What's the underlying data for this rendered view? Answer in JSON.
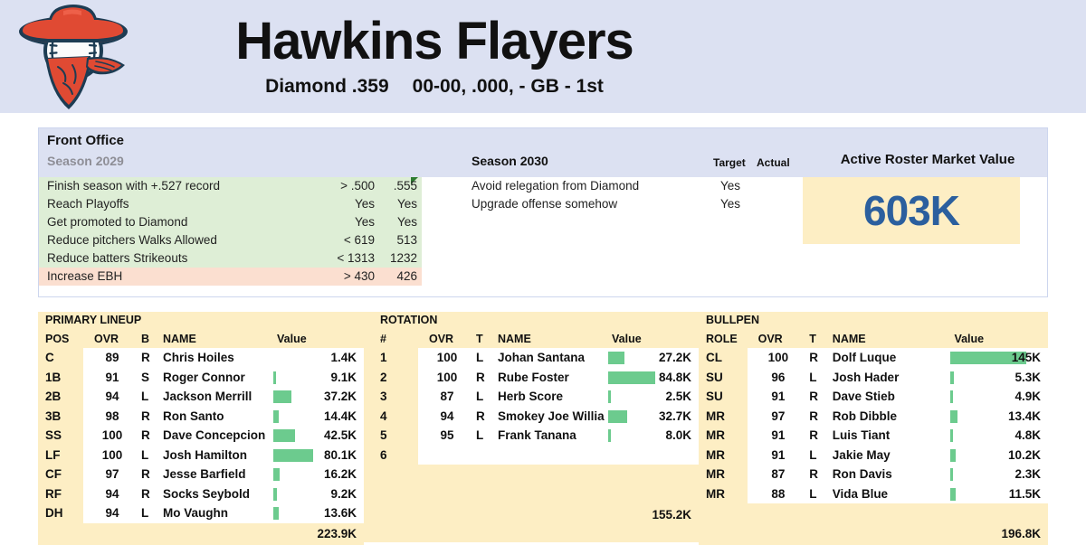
{
  "header": {
    "logo_icon": "outlaw-baseball-logo",
    "team_name": "Hawkins Flayers",
    "league": "Diamond .359",
    "record": "00-00, .000, - GB - 1st"
  },
  "front_office": {
    "panel_title": "Front Office",
    "left_season_label": "Season 2029",
    "right_season_label": "Season 2030",
    "target_header": "Target",
    "actual_header": "Actual",
    "market_value_title": "Active Roster Market Value",
    "market_value": "603K",
    "market_value_color": "#2b5f9e",
    "past_goals": [
      {
        "label": "Finish season with +.527 record",
        "target": "> .500",
        "actual": ".555",
        "status": "met",
        "flag": true
      },
      {
        "label": "Reach Playoffs",
        "target": "Yes",
        "actual": "Yes",
        "status": "met",
        "flag": false
      },
      {
        "label": "Get promoted to Diamond",
        "target": "Yes",
        "actual": "Yes",
        "status": "met",
        "flag": false
      },
      {
        "label": "Reduce pitchers Walks Allowed",
        "target": "< 619",
        "actual": "513",
        "status": "met",
        "flag": false
      },
      {
        "label": "Reduce batters Strikeouts",
        "target": "< 1313",
        "actual": "1232",
        "status": "met",
        "flag": false
      },
      {
        "label": "Increase EBH",
        "target": "> 430",
        "actual": "426",
        "status": "miss",
        "flag": false
      }
    ],
    "current_goals": [
      {
        "label": "Avoid relegation from Diamond",
        "target": "Yes",
        "actual": ""
      },
      {
        "label": "Upgrade offense somehow",
        "target": "Yes",
        "actual": ""
      }
    ]
  },
  "roster": {
    "lineup": {
      "section_title": "PRIMARY LINEUP",
      "headers": {
        "pos": "POS",
        "ovr": "OVR",
        "hand": "B",
        "name": "NAME",
        "value": "Value"
      },
      "rows": [
        {
          "pos": "C",
          "ovr": "89",
          "ovr_style": "ovr-yellow",
          "hand": "R",
          "name": "Chris Hoiles",
          "value": "1.4K",
          "bar_pct": 0
        },
        {
          "pos": "1B",
          "ovr": "91",
          "ovr_style": "ovr-green",
          "hand": "S",
          "name": "Roger Connor",
          "value": "9.1K",
          "bar_pct": 4
        },
        {
          "pos": "2B",
          "ovr": "94",
          "ovr_style": "ovr-green",
          "hand": "L",
          "name": "Jackson Merrill",
          "value": "37.2K",
          "bar_pct": 24
        },
        {
          "pos": "3B",
          "ovr": "98",
          "ovr_style": "ovr-green",
          "hand": "R",
          "name": "Ron Santo",
          "value": "14.4K",
          "bar_pct": 7
        },
        {
          "pos": "SS",
          "ovr": "100",
          "ovr_style": "ovr-black",
          "hand": "R",
          "name": "Dave Concepcion",
          "value": "42.5K",
          "bar_pct": 28
        },
        {
          "pos": "LF",
          "ovr": "100",
          "ovr_style": "ovr-black",
          "hand": "L",
          "name": "Josh Hamilton",
          "value": "80.1K",
          "bar_pct": 52
        },
        {
          "pos": "CF",
          "ovr": "97",
          "ovr_style": "ovr-green",
          "hand": "R",
          "name": "Jesse Barfield",
          "value": "16.2K",
          "bar_pct": 8
        },
        {
          "pos": "RF",
          "ovr": "94",
          "ovr_style": "ovr-green",
          "hand": "R",
          "name": "Socks Seybold",
          "value": "9.2K",
          "bar_pct": 5
        },
        {
          "pos": "DH",
          "ovr": "94",
          "ovr_style": "ovr-green",
          "hand": "L",
          "name": "Mo Vaughn",
          "value": "13.6K",
          "bar_pct": 7
        }
      ],
      "total": "223.9K"
    },
    "rotation": {
      "section_title": "ROTATION",
      "headers": {
        "pos": "#",
        "ovr": "OVR",
        "hand": "T",
        "name": "NAME",
        "value": "Value"
      },
      "rows": [
        {
          "pos": "1",
          "ovr": "100",
          "ovr_style": "ovr-black",
          "hand": "L",
          "name": "Johan Santana",
          "value": "27.2K",
          "bar_pct": 22,
          "small": false
        },
        {
          "pos": "2",
          "ovr": "100",
          "ovr_style": "ovr-black",
          "hand": "R",
          "name": "Rube Foster",
          "value": "84.8K",
          "bar_pct": 62,
          "small": false
        },
        {
          "pos": "3",
          "ovr": "87",
          "ovr_style": "ovr-yellow",
          "hand": "L",
          "name": "Herb Score",
          "value": "2.5K",
          "bar_pct": 3,
          "small": false
        },
        {
          "pos": "4",
          "ovr": "94",
          "ovr_style": "ovr-green",
          "hand": "R",
          "name": "Smokey Joe Williams",
          "value": "32.7K",
          "bar_pct": 25,
          "small": true
        },
        {
          "pos": "5",
          "ovr": "95",
          "ovr_style": "ovr-green",
          "hand": "L",
          "name": "Frank Tanana",
          "value": "8.0K",
          "bar_pct": 4,
          "small": false
        },
        {
          "pos": "6",
          "ovr": "",
          "ovr_style": "ovr-empty",
          "hand": "",
          "name": "",
          "value": "",
          "bar_pct": 0,
          "small": false
        }
      ],
      "total": "155.2K"
    },
    "bullpen": {
      "section_title": "BULLPEN",
      "headers": {
        "pos": "ROLE",
        "ovr": "OVR",
        "hand": "T",
        "name": "NAME",
        "value": "Value"
      },
      "rows": [
        {
          "pos": "CL",
          "ovr": "100",
          "ovr_style": "ovr-black",
          "hand": "R",
          "name": "Dolf Luque",
          "value": "145K",
          "bar_pct": 100
        },
        {
          "pos": "SU",
          "ovr": "96",
          "ovr_style": "ovr-green",
          "hand": "L",
          "name": "Josh Hader",
          "value": "5.3K",
          "bar_pct": 4
        },
        {
          "pos": "SU",
          "ovr": "91",
          "ovr_style": "ovr-green",
          "hand": "R",
          "name": "Dave Stieb",
          "value": "4.9K",
          "bar_pct": 3
        },
        {
          "pos": "MR",
          "ovr": "97",
          "ovr_style": "ovr-green",
          "hand": "R",
          "name": "Rob Dibble",
          "value": "13.4K",
          "bar_pct": 9
        },
        {
          "pos": "MR",
          "ovr": "91",
          "ovr_style": "ovr-green",
          "hand": "R",
          "name": "Luis Tiant",
          "value": "4.8K",
          "bar_pct": 3
        },
        {
          "pos": "MR",
          "ovr": "91",
          "ovr_style": "ovr-green",
          "hand": "L",
          "name": "Jakie May",
          "value": "10.2K",
          "bar_pct": 7
        },
        {
          "pos": "MR",
          "ovr": "87",
          "ovr_style": "ovr-yellow",
          "hand": "R",
          "name": "Ron Davis",
          "value": "2.3K",
          "bar_pct": 2
        },
        {
          "pos": "MR",
          "ovr": "88",
          "ovr_style": "ovr-yellow",
          "hand": "L",
          "name": "Vida Blue",
          "value": "11.5K",
          "bar_pct": 7
        }
      ],
      "total": "196.8K"
    }
  },
  "colors": {
    "header_bg": "#dce1f2",
    "panel_bg": "#fdeec4",
    "goal_met": "#deeed6",
    "goal_miss": "#fbdfd0",
    "bar_green": "#6ccb8e",
    "accent_blue": "#2b5f9e"
  }
}
